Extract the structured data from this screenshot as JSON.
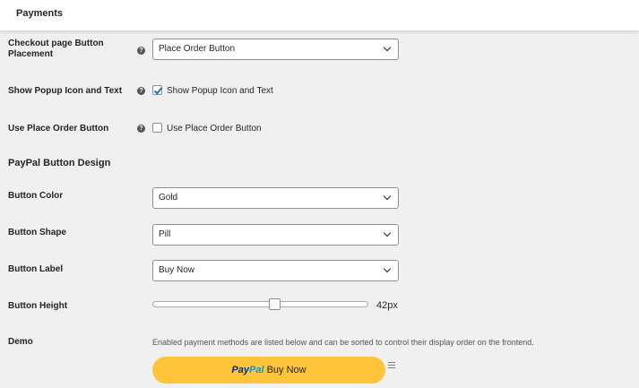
{
  "header": {
    "title": "Payments"
  },
  "settings": {
    "placement": {
      "label_line1": "Checkout page Button",
      "label_line2": "Placement",
      "help_glyph": "?",
      "value": "Place Order Button"
    },
    "popup": {
      "label": "Show Popup Icon and Text",
      "help_glyph": "?",
      "checkbox_label": "Show Popup Icon and Text",
      "checked": true
    },
    "use_place_order": {
      "label": "Use Place Order Button",
      "help_glyph": "?",
      "checkbox_label": "Use Place Order Button",
      "checked": false
    }
  },
  "design": {
    "heading": "PayPal Button Design",
    "color": {
      "label": "Button Color",
      "value": "Gold"
    },
    "shape": {
      "label": "Button Shape",
      "value": "Pill"
    },
    "button_label": {
      "label": "Button Label",
      "value": "Buy Now"
    },
    "height": {
      "label": "Button Height",
      "value_text": "42px",
      "fraction": 0.57
    },
    "demo": {
      "label": "Demo",
      "description": "Enabled payment methods are listed below and can be sorted to control their display order on the frontend.",
      "logo_pay": "Pay",
      "logo_pal": "Pal",
      "button_text": "Buy Now"
    }
  },
  "colors": {
    "paypal_gold": "#ffc439",
    "paypal_dark_blue": "#003087",
    "paypal_light_blue": "#009cde",
    "check_blue": "#2271b1"
  },
  "icons": {
    "help": "question-circle-icon",
    "chevron": "chevron-down-icon",
    "drag": "drag-handle-icon"
  }
}
